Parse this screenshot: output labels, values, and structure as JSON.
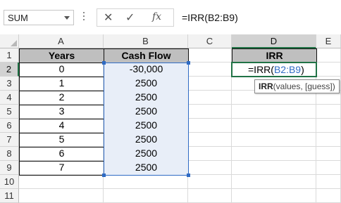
{
  "formula_bar": {
    "name_box": "SUM",
    "cancel_icon": "✕",
    "enter_icon": "✓",
    "fx_label": "fx",
    "formula": "=IRR(B2:B9)"
  },
  "columns": [
    "A",
    "B",
    "C",
    "D",
    "E"
  ],
  "rows": [
    "1",
    "2",
    "3",
    "4",
    "5",
    "6",
    "7",
    "8",
    "9",
    "10",
    "11"
  ],
  "table": {
    "header_years": "Years",
    "header_cash_flow": "Cash Flow",
    "header_irr": "IRR",
    "years": [
      "0",
      "1",
      "2",
      "3",
      "4",
      "5",
      "6",
      "7"
    ],
    "cash_flows": [
      "-30,000",
      "2500",
      "2500",
      "2500",
      "2500",
      "2500",
      "2500",
      "2500"
    ]
  },
  "editing_cell": {
    "prefix": "=IRR(",
    "ref": "B2:B9",
    "suffix": ")"
  },
  "tooltip": {
    "func": "IRR",
    "args": "(values, [guess])"
  },
  "colors": {
    "selection_green": "#217346",
    "range_blue": "#2f6bc4",
    "header_fill": "#bfbfbf"
  }
}
